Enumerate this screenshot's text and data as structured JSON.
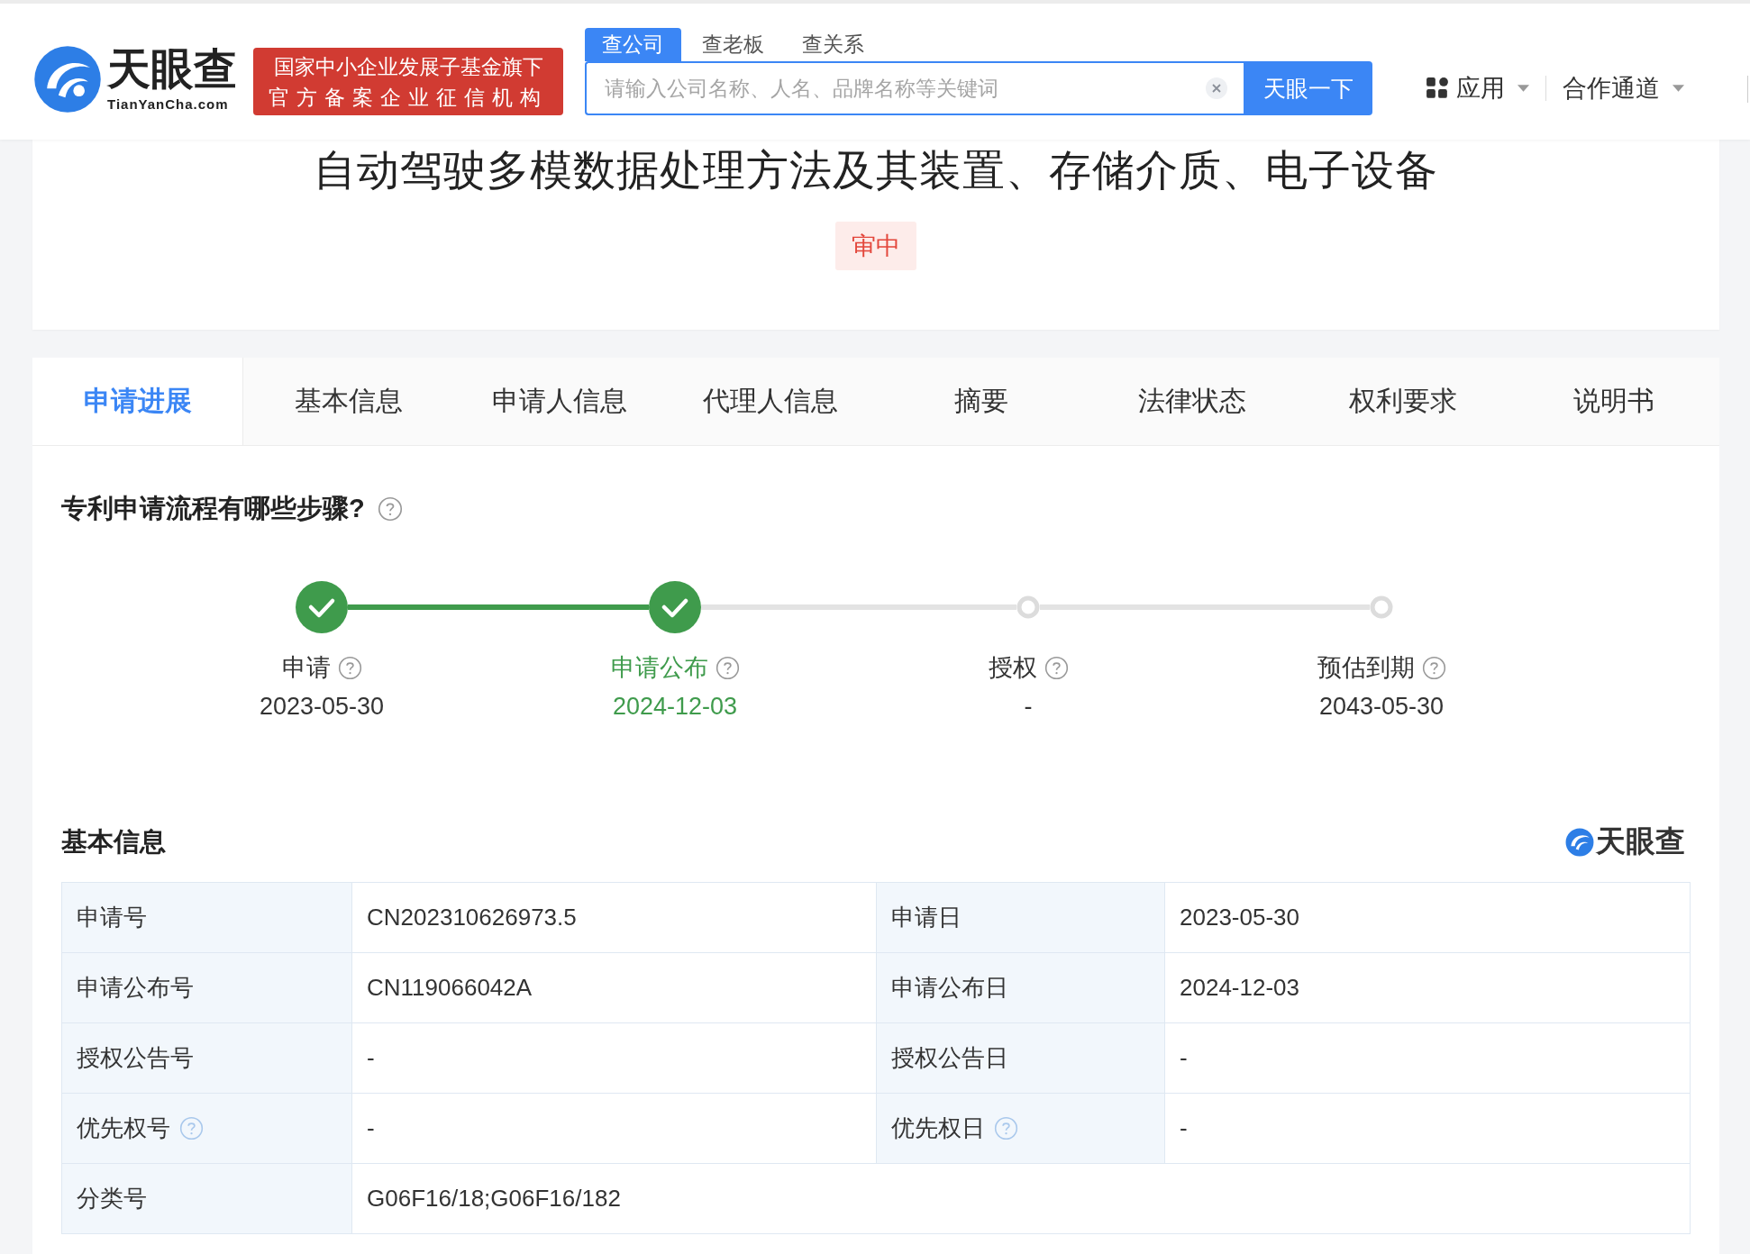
{
  "header": {
    "logo_text": "天眼查",
    "logo_domain": "TianYanCha.com",
    "badge_lines": [
      "国家中小企业发展子基金旗下",
      "官方备案企业征信机构"
    ],
    "search_tabs": [
      {
        "label": "查公司",
        "selected": true
      },
      {
        "label": "查老板",
        "selected": false
      },
      {
        "label": "查关系",
        "selected": false
      }
    ],
    "search": {
      "placeholder": "请输入公司名称、人名、品牌名称等关键词"
    },
    "search_button": "天眼一下",
    "nav": [
      {
        "label": "应用",
        "kind": "apps"
      },
      {
        "label": "合作通道",
        "kind": "plain"
      }
    ]
  },
  "patent": {
    "title": "自动驾驶多模数据处理方法及其装置、存储介质、电子设备",
    "status": "审中"
  },
  "tabs": [
    {
      "label": "申请进展",
      "selected": true
    },
    {
      "label": "基本信息",
      "selected": false
    },
    {
      "label": "申请人信息",
      "selected": false
    },
    {
      "label": "代理人信息",
      "selected": false
    },
    {
      "label": "摘要",
      "selected": false
    },
    {
      "label": "法律状态",
      "selected": false
    },
    {
      "label": "权利要求",
      "selected": false
    },
    {
      "label": "说明书",
      "selected": false
    }
  ],
  "progress": {
    "heading": "专利申请流程有哪些步骤?",
    "steps": [
      {
        "label": "申请",
        "date": "2023-05-30",
        "done": true,
        "current": false
      },
      {
        "label": "申请公布",
        "date": "2024-12-03",
        "done": true,
        "current": true
      },
      {
        "label": "授权",
        "date": "-",
        "done": false,
        "current": false
      },
      {
        "label": "预估到期",
        "date": "2043-05-30",
        "done": false,
        "current": false
      }
    ]
  },
  "basic_info": {
    "heading": "基本信息",
    "logo_text": "天眼查",
    "rows": [
      {
        "cells": [
          {
            "label": "申请号",
            "value": "CN202310626973.5",
            "help": false
          },
          {
            "label": "申请日",
            "value": "2023-05-30",
            "help": false
          }
        ]
      },
      {
        "cells": [
          {
            "label": "申请公布号",
            "value": "CN119066042A",
            "help": false
          },
          {
            "label": "申请公布日",
            "value": "2024-12-03",
            "help": false
          }
        ]
      },
      {
        "cells": [
          {
            "label": "授权公告号",
            "value": "-",
            "help": false
          },
          {
            "label": "授权公告日",
            "value": "-",
            "help": false
          }
        ]
      },
      {
        "cells": [
          {
            "label": "优先权号",
            "value": "-",
            "help": true
          },
          {
            "label": "优先权日",
            "value": "-",
            "help": true
          }
        ]
      },
      {
        "cells": [
          {
            "label": "分类号",
            "value": "G06F16/18;G06F16/182",
            "help": false
          }
        ]
      }
    ]
  }
}
